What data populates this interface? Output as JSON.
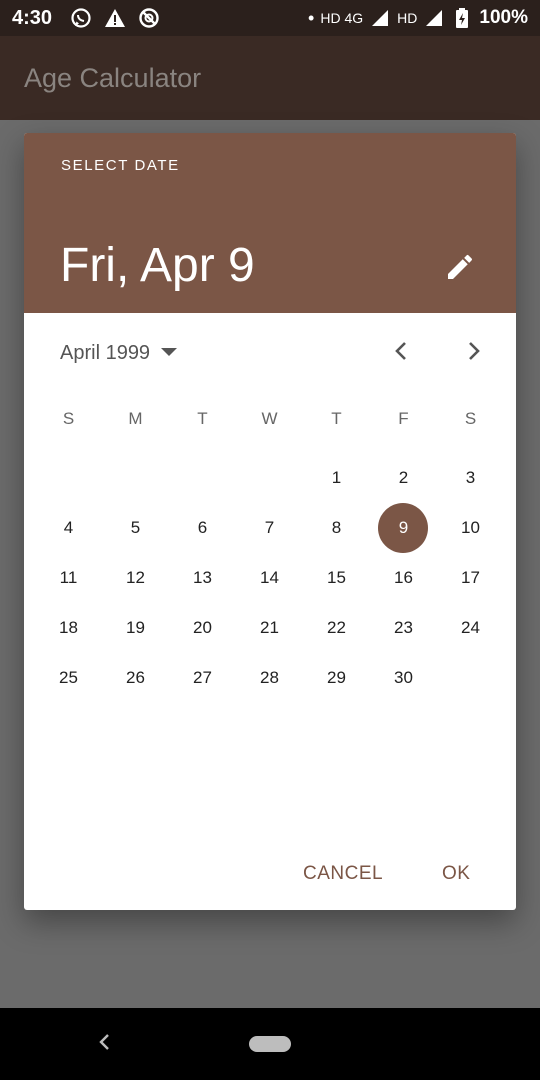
{
  "status_bar": {
    "time": "4:30",
    "network_text": "HD 4G",
    "network_text2": "HD",
    "battery": "100%",
    "icons": [
      "whatsapp-icon",
      "warning-icon",
      "sync-disabled-icon",
      "dot-icon",
      "signal-icon",
      "signal-icon",
      "battery-charging-icon"
    ]
  },
  "app_bar": {
    "title": "Age Calculator"
  },
  "dialog": {
    "header_label": "SELECT DATE",
    "selected_date": "Fri, Apr 9",
    "month_year": "April 1999",
    "weekdays": [
      "S",
      "M",
      "T",
      "W",
      "T",
      "F",
      "S"
    ],
    "days": [
      "",
      "",
      "",
      "",
      "1",
      "2",
      "3",
      "4",
      "5",
      "6",
      "7",
      "8",
      "9",
      "10",
      "11",
      "12",
      "13",
      "14",
      "15",
      "16",
      "17",
      "18",
      "19",
      "20",
      "21",
      "22",
      "23",
      "24",
      "25",
      "26",
      "27",
      "28",
      "29",
      "30",
      ""
    ],
    "selected_day": "9",
    "cancel_label": "CANCEL",
    "ok_label": "OK"
  },
  "colors": {
    "accent": "#7b5646",
    "status_bar": "#2b201c",
    "app_bar_dimmed": "#3a2a24",
    "scrim": "#6b6b6b"
  }
}
